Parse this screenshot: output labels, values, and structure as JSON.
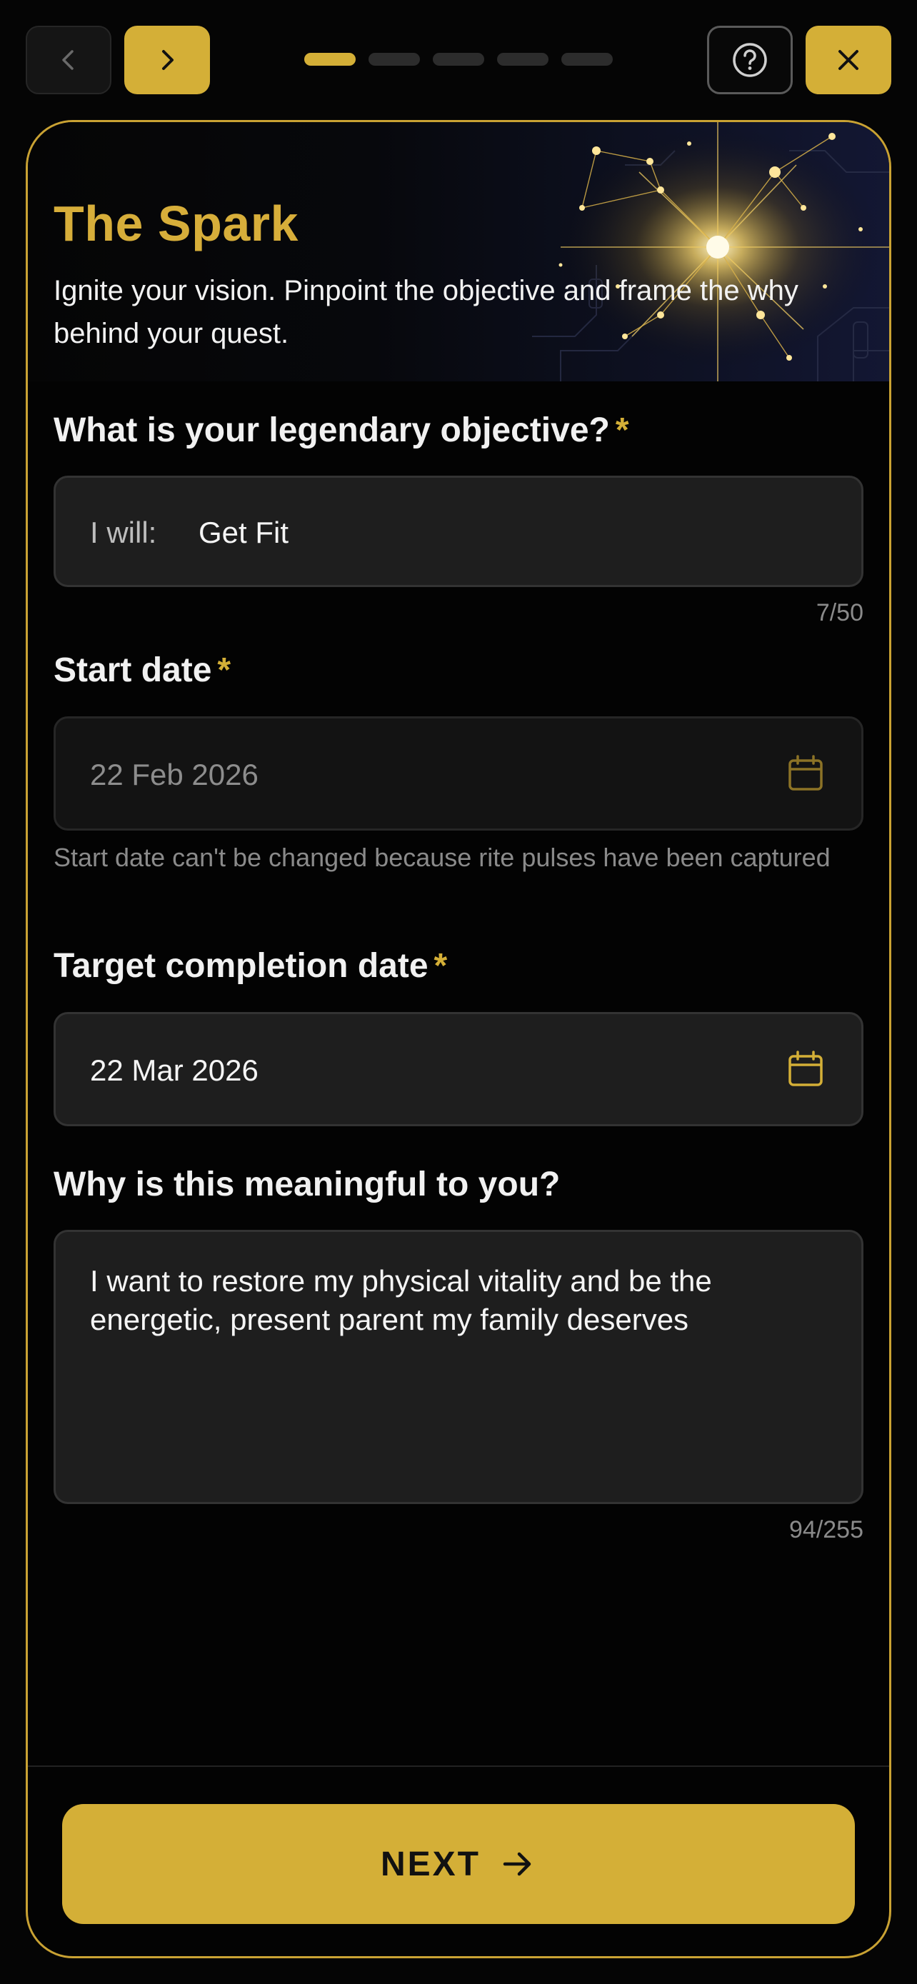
{
  "nav": {
    "back_icon": "chevron-left-icon",
    "forward_icon": "chevron-right-icon",
    "help_icon": "question-circle-icon",
    "close_icon": "close-icon",
    "progress": {
      "total_steps": 5,
      "current_step": 1
    }
  },
  "hero": {
    "title": "The Spark",
    "subtitle": "Ignite your vision. Pinpoint the objective and frame the why behind your quest."
  },
  "objective": {
    "label": "What is your legendary objective?",
    "required_mark": "*",
    "prefix": "I will:",
    "value": "Get Fit",
    "counter": "7/50"
  },
  "start_date": {
    "label": "Start date",
    "required_mark": "*",
    "value": "22 Feb 2026",
    "helper": "Start date can't be changed because rite pulses have been captured",
    "icon": "calendar-icon"
  },
  "target_date": {
    "label": "Target completion date",
    "required_mark": "*",
    "value": "22 Mar 2026",
    "icon": "calendar-icon"
  },
  "meaning": {
    "label": "Why is this meaningful to you?",
    "value": "I want to restore my physical vitality and be the energetic, present parent my family deserves",
    "counter": "94/255"
  },
  "footer": {
    "next_label": "NEXT",
    "next_icon": "arrow-right-icon"
  },
  "colors": {
    "accent": "#d4af37",
    "background": "#050505",
    "field": "#1e1e1e"
  }
}
